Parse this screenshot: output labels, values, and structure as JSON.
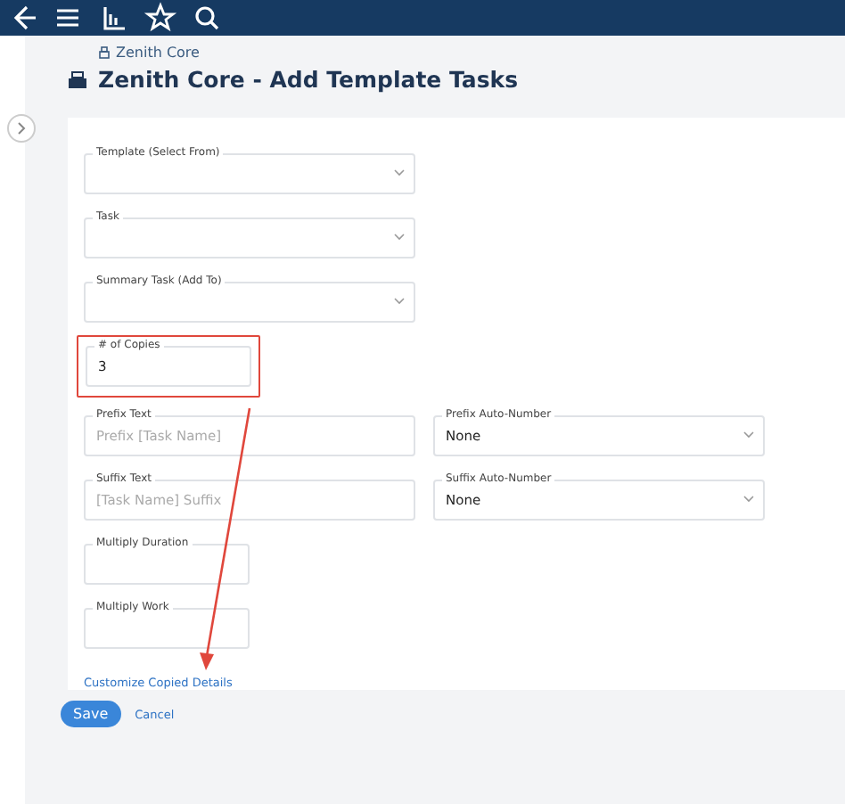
{
  "toolbar": {
    "items": [
      {
        "kind": "back"
      },
      {
        "kind": "menu"
      },
      {
        "kind": "chart"
      },
      {
        "kind": "star"
      },
      {
        "kind": "search"
      }
    ]
  },
  "breadcrumb": "Zenith Core",
  "title": "Zenith Core - Add Template Tasks",
  "form": {
    "rows": [
      [
        {
          "kind": "select",
          "label": "Template (Select From)"
        }
      ],
      [
        {
          "kind": "select",
          "label": "Task"
        }
      ],
      [
        {
          "kind": "select",
          "label": "Summary Task (Add To)"
        }
      ],
      [
        {
          "kind": "input",
          "label": "# of Copies",
          "value": "3",
          "highlighted": true
        }
      ],
      [
        {
          "kind": "input",
          "label": "Prefix Text",
          "placeholder": "Prefix [Task Name]"
        },
        {
          "kind": "select",
          "label": "Prefix Auto-Number",
          "value": "None"
        }
      ],
      [
        {
          "kind": "input",
          "label": "Suffix Text",
          "placeholder": "[Task Name] Suffix"
        },
        {
          "kind": "select",
          "label": "Suffix Auto-Number",
          "value": "None"
        }
      ],
      [
        {
          "kind": "small",
          "label": "Multiply Duration"
        }
      ],
      [
        {
          "kind": "small",
          "label": "Multiply Work"
        }
      ]
    ],
    "link": "Customize Copied Details"
  },
  "buttons": {
    "save": "Save",
    "cancel": "Cancel"
  }
}
